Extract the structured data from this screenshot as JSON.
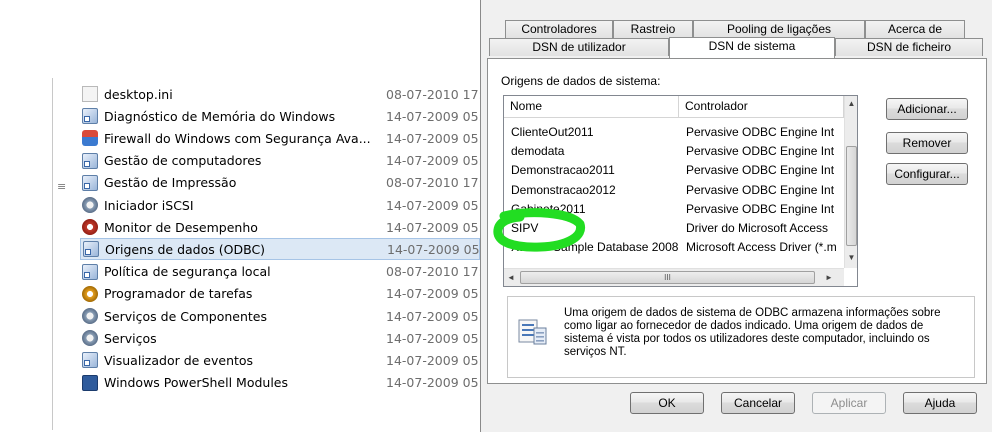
{
  "explorer": {
    "files": [
      {
        "name": "desktop.ini",
        "date": "08-07-2010 17:",
        "icon": "ini-file-icon"
      },
      {
        "name": "Diagnóstico de Memória do Windows",
        "date": "14-07-2009 05:",
        "icon": "memory-diagnostic-icon"
      },
      {
        "name": "Firewall do Windows com Segurança Ava...",
        "date": "14-07-2009 05:",
        "icon": "firewall-icon"
      },
      {
        "name": "Gestão de computadores",
        "date": "14-07-2009 05:",
        "icon": "computer-management-icon"
      },
      {
        "name": "Gestão de Impressão",
        "date": "08-07-2010 17:",
        "icon": "print-management-icon"
      },
      {
        "name": "Iniciador iSCSI",
        "date": "14-07-2009 05:",
        "icon": "iscsi-icon"
      },
      {
        "name": "Monitor de Desempenho",
        "date": "14-07-2009 05:",
        "icon": "performance-monitor-icon"
      },
      {
        "name": "Origens de dados (ODBC)",
        "date": "14-07-2009 05:",
        "icon": "odbc-icon",
        "selected": true
      },
      {
        "name": "Política de segurança local",
        "date": "08-07-2010 17:",
        "icon": "security-policy-icon"
      },
      {
        "name": "Programador de tarefas",
        "date": "14-07-2009 05:",
        "icon": "task-scheduler-icon"
      },
      {
        "name": "Serviços de Componentes",
        "date": "14-07-2009 05:",
        "icon": "component-services-icon"
      },
      {
        "name": "Serviços",
        "date": "14-07-2009 05:",
        "icon": "services-icon"
      },
      {
        "name": "Visualizador de eventos",
        "date": "14-07-2009 05:",
        "icon": "event-viewer-icon"
      },
      {
        "name": "Windows PowerShell Modules",
        "date": "14-07-2009 05:",
        "icon": "powershell-icon"
      }
    ]
  },
  "dialog": {
    "tabs_back": [
      "Controladores",
      "Rastreio",
      "Pooling de ligações",
      "Acerca de"
    ],
    "tabs_front": [
      "DSN de utilizador",
      "DSN de sistema",
      "DSN de ficheiro"
    ],
    "active_tab": "DSN de sistema",
    "list_label": "Origens de dados de sistema:",
    "columns": [
      "Nome",
      "Controlador"
    ],
    "data_sources": [
      {
        "name": "ClienteOut2011",
        "driver": "Pervasive ODBC Engine Int"
      },
      {
        "name": "demodata",
        "driver": "Pervasive ODBC Engine Int"
      },
      {
        "name": "Demonstracao2011",
        "driver": "Pervasive ODBC Engine Int"
      },
      {
        "name": "Demonstracao2012",
        "driver": "Pervasive ODBC Engine Int"
      },
      {
        "name": "Gabinete2011",
        "driver": "Pervasive ODBC Engine Int"
      },
      {
        "name": "SIPV",
        "driver": "Driver do Microsoft Access",
        "selected": true
      },
      {
        "name": "Xtreme Sample Database 2008",
        "driver": "Microsoft Access Driver (*.m"
      }
    ],
    "side_buttons": {
      "add": "Adicionar...",
      "remove": "Remover",
      "configure": "Configurar..."
    },
    "info_text": "Uma origem de dados de sistema de ODBC armazena informações sobre como ligar ao fornecedor de dados indicado. Uma origem de dados de sistema é vista por todos os utilizadores deste computador, incluindo os serviços NT.",
    "footer_buttons": {
      "ok": "OK",
      "cancel": "Cancelar",
      "apply": "Aplicar",
      "help": "Ajuda"
    },
    "scroll_glyphs": {
      "up": "▲",
      "down": "▼",
      "left": "◄",
      "right": "►",
      "grip": "III"
    },
    "highlight_color": "#22dd22"
  },
  "misc": {
    "splitter_glyph": "≡"
  }
}
